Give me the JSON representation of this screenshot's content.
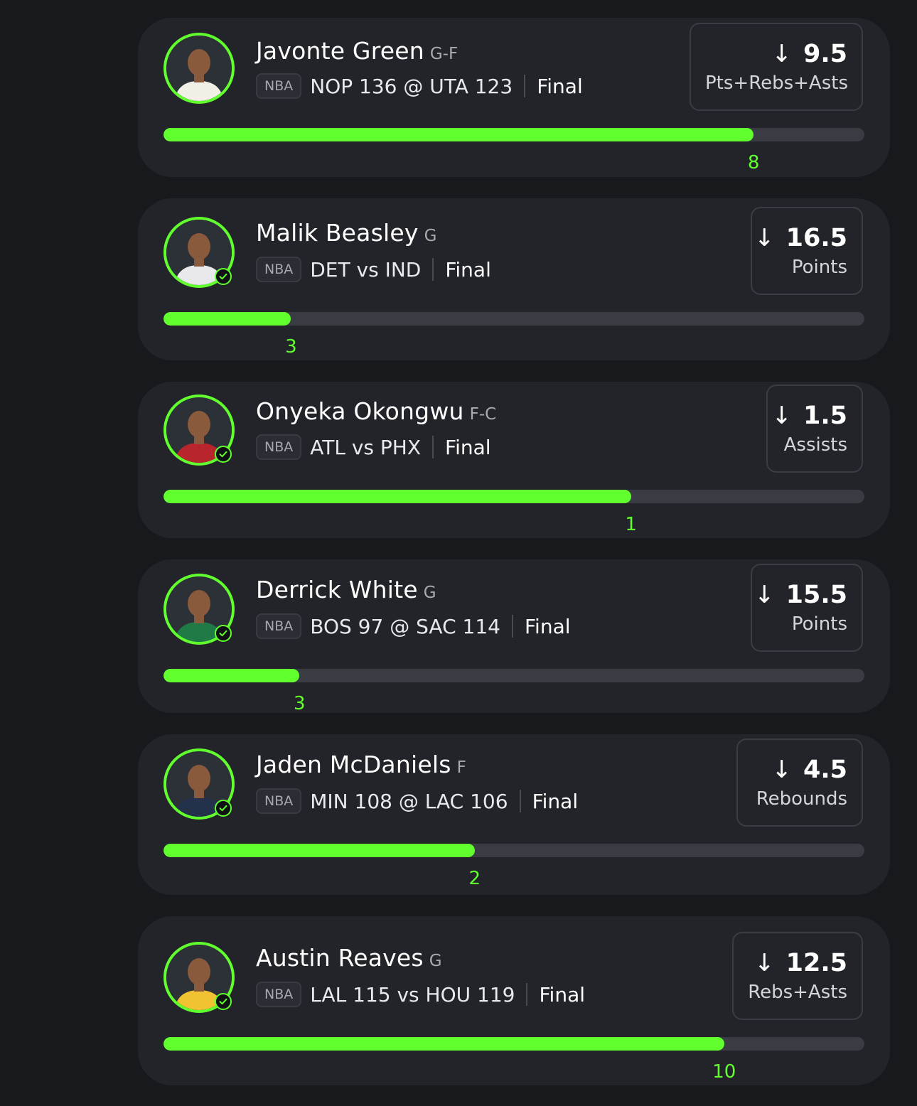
{
  "accent_color": "#62ff2e",
  "league": "NBA",
  "picks": [
    {
      "player": "Javonte Green",
      "position": "G-F",
      "league": "NBA",
      "matchup": "NOP 136 @ UTA 123",
      "status": "Final",
      "direction_icon": "arrow-down-icon",
      "line": "9.5",
      "stat": "Pts+Rebs+Asts",
      "actual": "8",
      "progress_fraction": 0.842,
      "jersey_color": "#f1efe6",
      "verified": false
    },
    {
      "player": "Malik Beasley",
      "position": "G",
      "league": "NBA",
      "matchup": "DET vs IND",
      "status": "Final",
      "direction_icon": "arrow-down-icon",
      "line": "16.5",
      "stat": "Points",
      "actual": "3",
      "progress_fraction": 0.182,
      "jersey_color": "#e9e9ec",
      "verified": true
    },
    {
      "player": "Onyeka Okongwu",
      "position": "F-C",
      "league": "NBA",
      "matchup": "ATL vs PHX",
      "status": "Final",
      "direction_icon": "arrow-down-icon",
      "line": "1.5",
      "stat": "Assists",
      "actual": "1",
      "progress_fraction": 0.667,
      "jersey_color": "#b8252c",
      "verified": true
    },
    {
      "player": "Derrick White",
      "position": "G",
      "league": "NBA",
      "matchup": "BOS 97 @ SAC 114",
      "status": "Final",
      "direction_icon": "arrow-down-icon",
      "line": "15.5",
      "stat": "Points",
      "actual": "3",
      "progress_fraction": 0.194,
      "jersey_color": "#1f7a45",
      "verified": true
    },
    {
      "player": "Jaden McDaniels",
      "position": "F",
      "league": "NBA",
      "matchup": "MIN 108 @ LAC 106",
      "status": "Final",
      "direction_icon": "arrow-down-icon",
      "line": "4.5",
      "stat": "Rebounds",
      "actual": "2",
      "progress_fraction": 0.444,
      "jersey_color": "#23324a",
      "verified": true
    },
    {
      "player": "Austin Reaves",
      "position": "G",
      "league": "NBA",
      "matchup": "LAL 115 vs HOU 119",
      "status": "Final",
      "direction_icon": "arrow-down-icon",
      "line": "12.5",
      "stat": "Rebs+Asts",
      "actual": "10",
      "progress_fraction": 0.8,
      "jersey_color": "#f1c232",
      "verified": true
    }
  ]
}
